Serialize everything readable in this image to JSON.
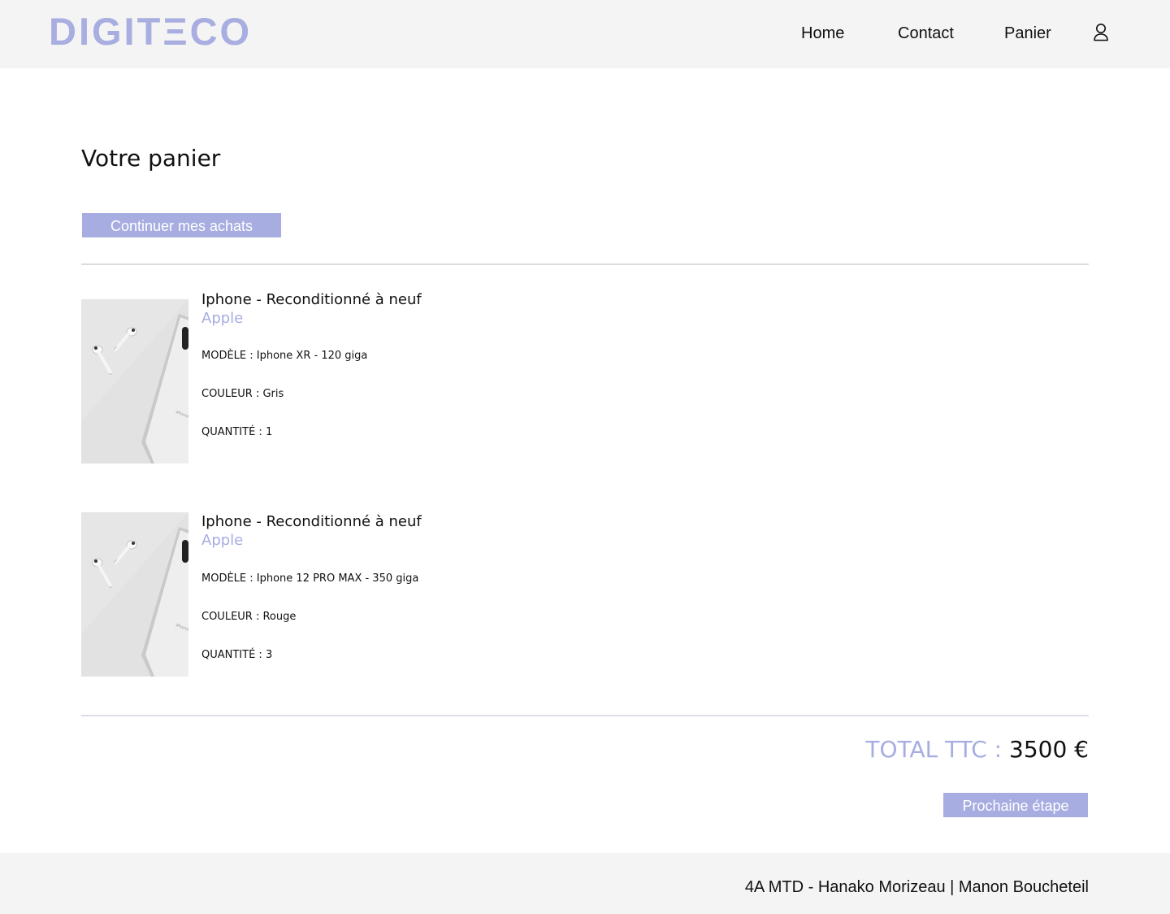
{
  "header": {
    "logo": "DIGITΞCO",
    "nav": {
      "home": "Home",
      "contact": "Contact",
      "panier": "Panier"
    },
    "user_icon": "user-icon"
  },
  "main": {
    "title": "Votre panier",
    "continue_button": "Continuer mes achats",
    "items": [
      {
        "name": "Iphone -  Reconditionné à neuf",
        "brand": "Apple",
        "model": "MODÈLE :  Iphone XR - 120 giga",
        "color": "COULEUR : Gris",
        "quantity": "QUANTITÉ :  1"
      },
      {
        "name": "Iphone -  Reconditionné à neuf",
        "brand": "Apple",
        "model": "MODÈLE :  Iphone 12  PRO  MAX - 350 giga",
        "color": "COULEUR :  Rouge",
        "quantity": "QUANTITÉ :  3"
      }
    ],
    "total_label": "TOTAL TTC : ",
    "total_value": "3500 €",
    "next_button": "Prochaine étape"
  },
  "footer": {
    "text": "4A MTD - Hanako Morizeau | Manon Boucheteil"
  },
  "colors": {
    "accent": "#a7ade1",
    "header_bg": "#f4f4f4",
    "text": "#111111"
  }
}
